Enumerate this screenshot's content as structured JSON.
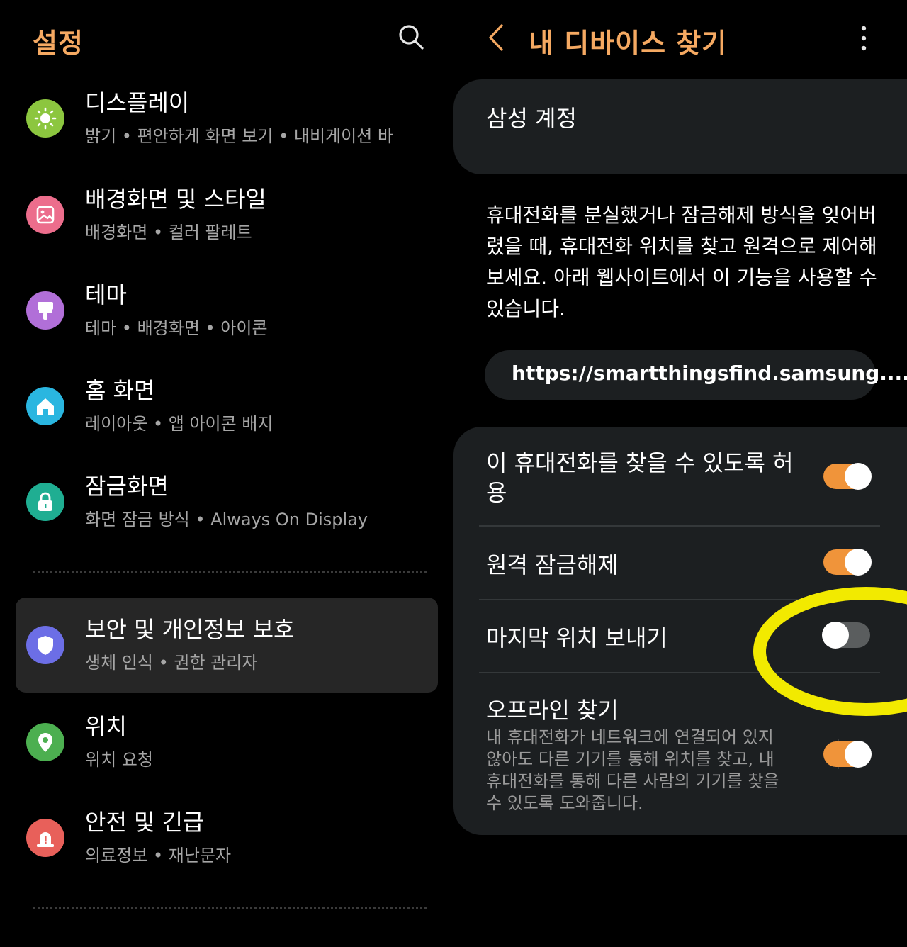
{
  "left": {
    "title": "설정",
    "items": [
      {
        "title": "디스플레이",
        "subtitle": "밝기 • 편안하게 화면 보기 • 내비게이션 바",
        "icon": "display-brightness-icon",
        "color": "#8cc63f"
      },
      {
        "title": "배경화면 및 스타일",
        "subtitle": "배경화면 • 컬러 팔레트",
        "icon": "wallpaper-icon",
        "color": "#ec6d8c"
      },
      {
        "title": "테마",
        "subtitle": "테마 • 배경화면 • 아이콘",
        "icon": "theme-brush-icon",
        "color": "#b16fd8"
      },
      {
        "title": "홈 화면",
        "subtitle": "레이아웃 • 앱 아이콘 배지",
        "icon": "home-icon",
        "color": "#2ab6e0"
      },
      {
        "title": "잠금화면",
        "subtitle": "화면 잠금 방식 • Always On Display",
        "icon": "lock-icon",
        "color": "#1fae92"
      },
      {
        "title": "보안 및 개인정보 보호",
        "subtitle": "생체 인식 • 권한 관리자",
        "icon": "shield-icon",
        "color": "#6c6ee6",
        "selected": true
      },
      {
        "title": "위치",
        "subtitle": "위치 요청",
        "icon": "location-pin-icon",
        "color": "#4caf50"
      },
      {
        "title": "안전 및 긴급",
        "subtitle": "의료정보 • 재난문자",
        "icon": "emergency-alert-icon",
        "color": "#e8605a"
      }
    ]
  },
  "right": {
    "title": "내 디바이스 찾기",
    "account_label": "삼성 계정",
    "description": "휴대전화를 분실했거나 잠금해제 방식을 잊어버렸을 때, 휴대전화 위치를 찾고 원격으로 제어해 보세요. 아래 웹사이트에서 이 기능을 사용할 수 있습니다.",
    "url": "https://smartthingsfind.samsung....",
    "toggles": [
      {
        "label": "이 휴대전화를 찾을 수 있도록 허용",
        "on": true
      },
      {
        "label": "원격 잠금해제",
        "on": true
      },
      {
        "label": "마지막 위치 보내기",
        "on": false
      },
      {
        "label": "오프라인 찾기",
        "subtitle": "내 휴대전화가 네트워크에 연결되어 있지 않아도 다른 기기를 통해 위치를 찾고, 내 휴대전화를 통해 다른 사람의 기기를 찾을 수 있도록 도와줍니다.",
        "on": true
      }
    ]
  },
  "colors": {
    "accent": "#f5a962",
    "toggle_on": "#f0943a",
    "toggle_off": "#5a5d5e",
    "highlight": "#f2ea00"
  }
}
